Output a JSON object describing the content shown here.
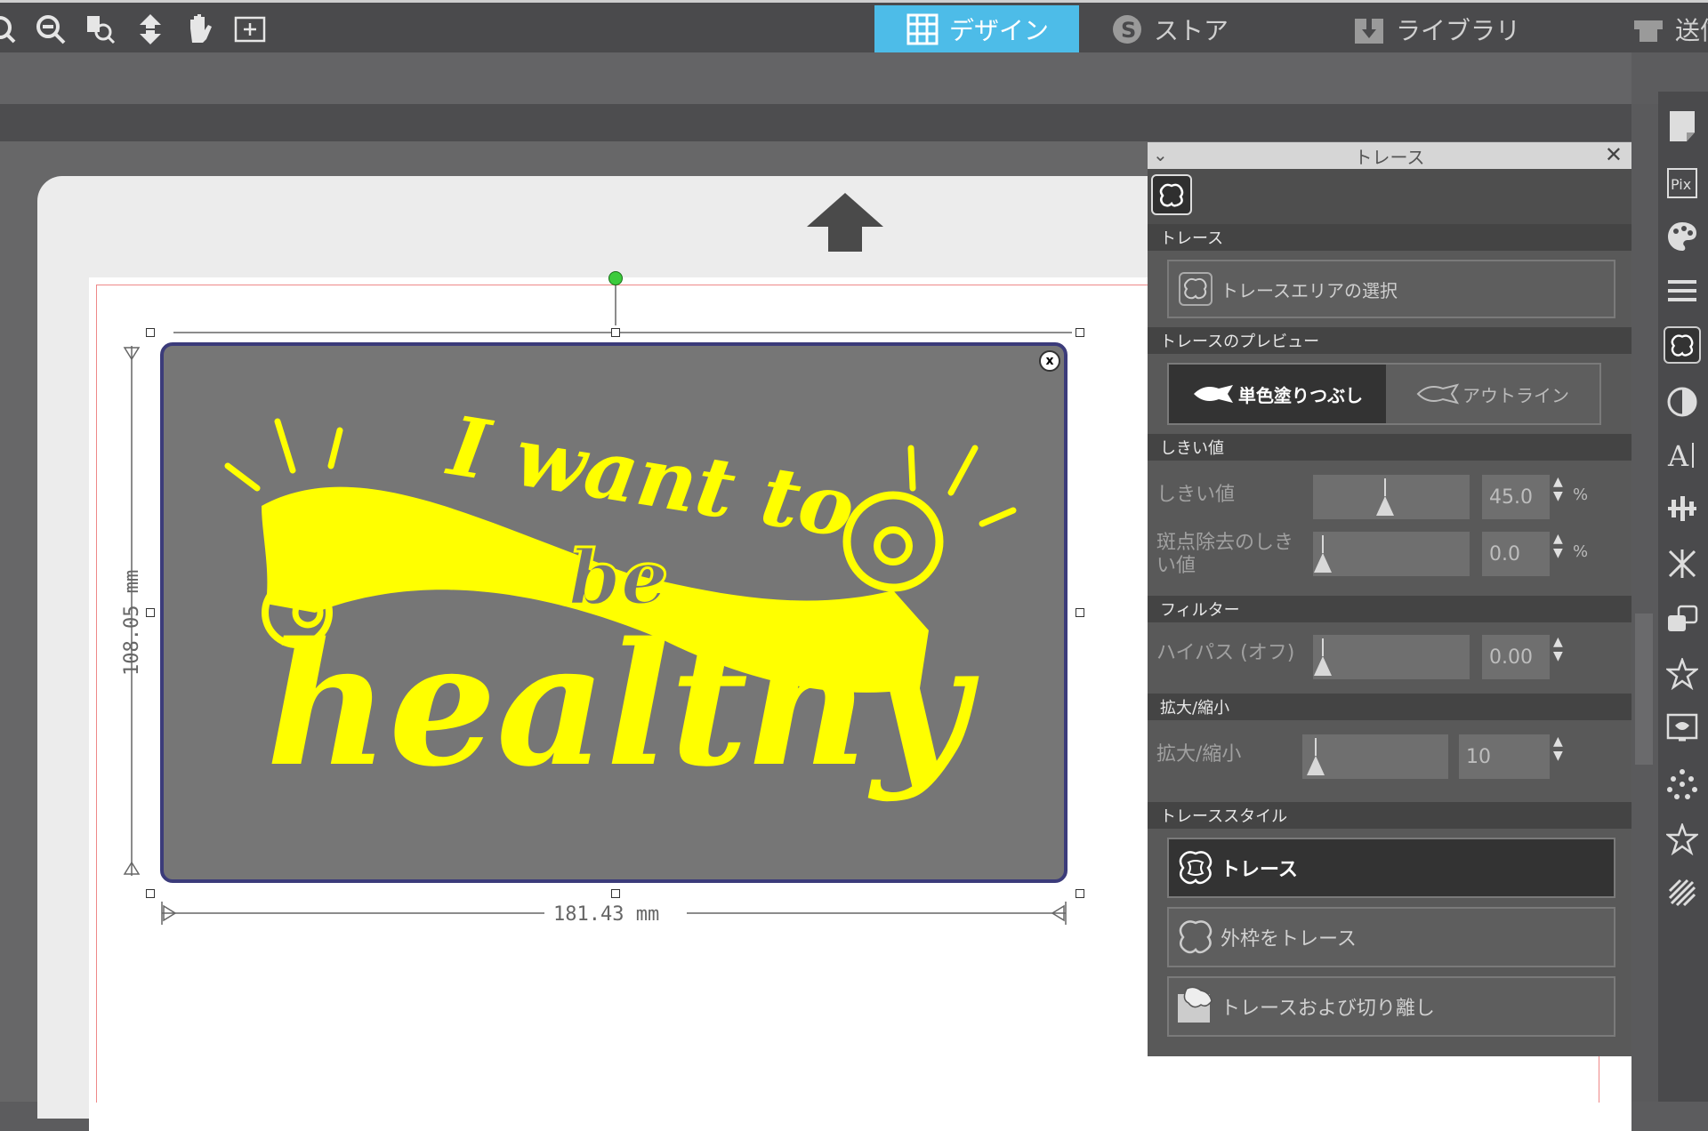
{
  "tabs": [
    {
      "label": "デザイン",
      "icon": "grid-icon",
      "active": true
    },
    {
      "label": "ストア",
      "icon": "store-icon",
      "active": false
    },
    {
      "label": "ライブラリ",
      "icon": "library-icon",
      "active": false
    },
    {
      "label": "送信",
      "icon": "send-icon",
      "active": false
    }
  ],
  "canvas": {
    "width_label": "181.43 mm",
    "height_label": "108.05 mm",
    "close_label": "x",
    "design_text": {
      "line1": "I want to",
      "line2": "be",
      "line3": "healthy"
    }
  },
  "panel": {
    "title": "トレース",
    "close": "✕",
    "sections": {
      "trace": "トレース",
      "preview": "トレースのプレビュー",
      "threshold": "しきい値",
      "filter": "フィルター",
      "scale": "拡大/縮小",
      "style": "トレーススタイル"
    },
    "select_area_label": "トレースエリアの選択",
    "preview_fill_label": "単色塗りつぶし",
    "preview_outline_label": "アウトライン",
    "threshold_label": "しきい値",
    "threshold_value": "45.0",
    "threshold_unit": "%",
    "threshold_level": 0.45,
    "speck_label": "斑点除去のしきい値",
    "speck_value": "0.0",
    "speck_unit": "%",
    "highpass_label": "ハイパス (オフ)",
    "highpass_value": "0.00",
    "scale_label": "拡大/縮小",
    "scale_value": "10",
    "style_trace": "トレース",
    "style_outer": "外枠をトレース",
    "style_detach": "トレースおよび切り離し"
  },
  "colors": {
    "accent": "#4dbce8",
    "design_fill": "#ffff00",
    "selection": "#3b3b7a"
  }
}
